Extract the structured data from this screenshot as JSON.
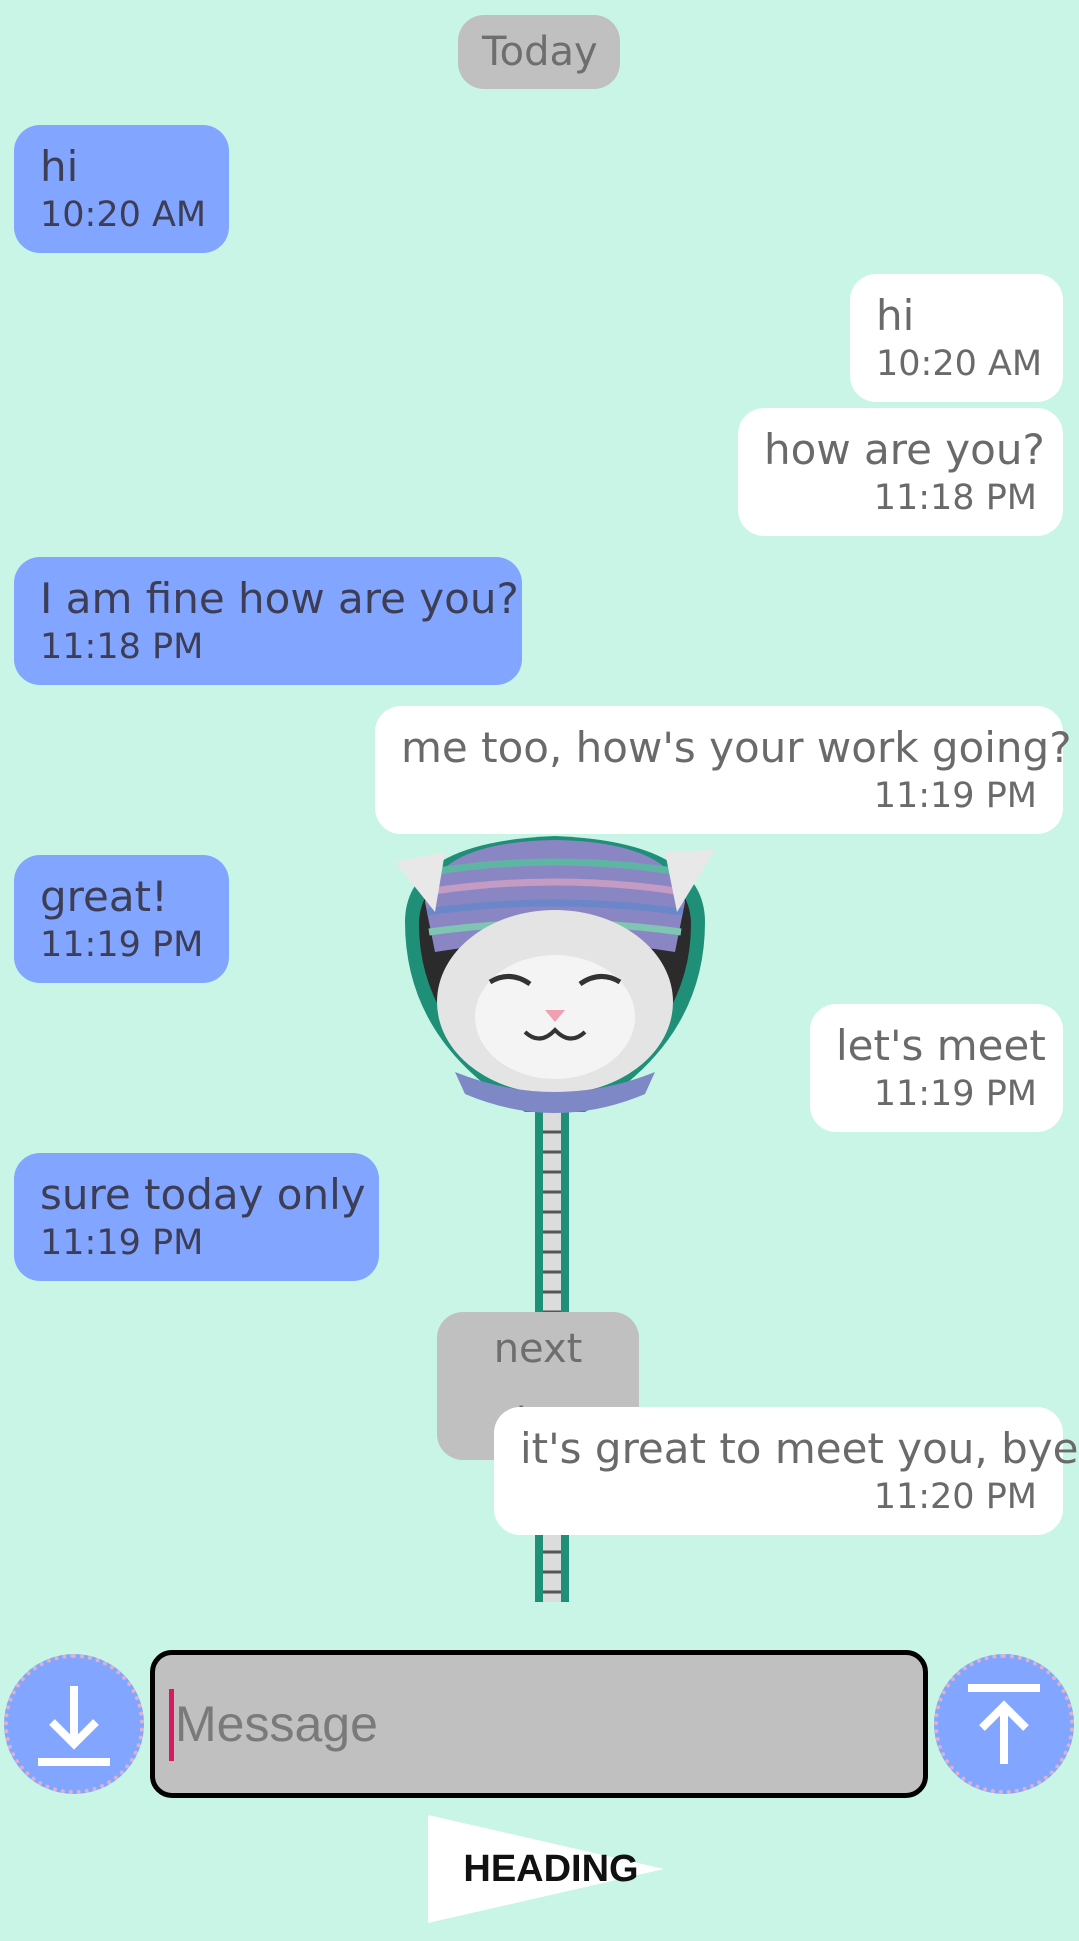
{
  "dates": {
    "first": "Today",
    "second": "next day"
  },
  "messages": [
    {
      "side": "in",
      "text": "hi",
      "time": "10:20 AM"
    },
    {
      "side": "out",
      "text": "hi",
      "time": "10:20 AM"
    },
    {
      "side": "out",
      "text": "how are you?",
      "time": "11:18 PM"
    },
    {
      "side": "in",
      "text": "I am fine how are you?",
      "time": "11:18 PM"
    },
    {
      "side": "out",
      "text": "me too, how's your work going?",
      "time": "11:19 PM"
    },
    {
      "side": "in",
      "text": "great!",
      "time": "11:19 PM"
    },
    {
      "side": "out",
      "text": "let's meet",
      "time": "11:19 PM"
    },
    {
      "side": "in",
      "text": "sure today only",
      "time": "11:19 PM"
    },
    {
      "side": "out",
      "text": "it's great to meet you, bye",
      "time": "11:20 PM"
    }
  ],
  "sticker": {
    "icon": "cat-in-zipper-sticker"
  },
  "composer": {
    "placeholder": "Message",
    "value": "",
    "left_button_icon": "download-icon",
    "right_button_icon": "upload-icon"
  },
  "footer": {
    "heading": "HEADING"
  },
  "colors": {
    "background": "#c8f5e6",
    "incoming_bubble": "#82a6ff",
    "outgoing_bubble": "#ffffff",
    "date_pill": "#c0c0c0",
    "caret": "#d81b60"
  }
}
